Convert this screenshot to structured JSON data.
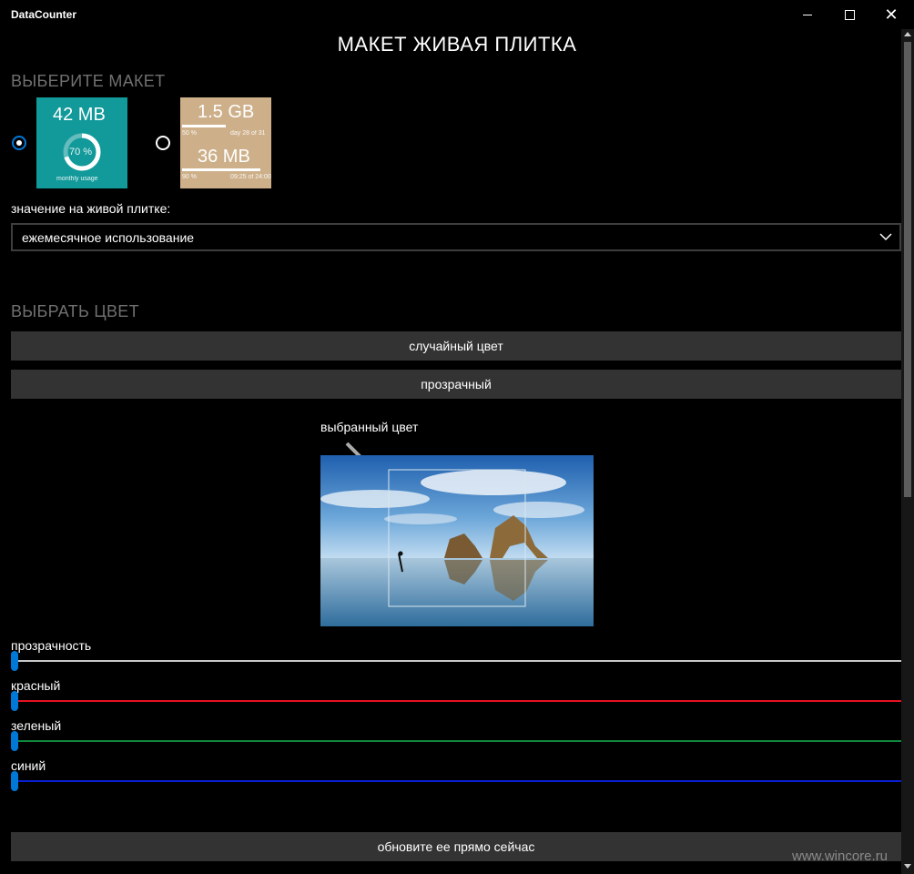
{
  "window": {
    "title": "DataCounter"
  },
  "page": {
    "heading": "МАКЕТ ЖИВАЯ ПЛИТКА"
  },
  "layout_section": {
    "title": "ВЫБЕРИТЕ МАКЕТ",
    "options": [
      {
        "selected": true,
        "tile": {
          "color": "#12999a",
          "value": "42 MB",
          "percent": "70 %",
          "percent_value": 0.7,
          "caption": "monthly usage"
        }
      },
      {
        "selected": false,
        "tile": {
          "color": "#cdb08a",
          "value1": "1.5 GB",
          "percent1": "50 %",
          "day": "day 28 of 31",
          "value2": "36 MB",
          "percent2": "90 %",
          "time": "09:25 of 24:00"
        }
      }
    ],
    "value_label": "значение на живой плитке:",
    "value_selected": "ежемесячное использование"
  },
  "color_section": {
    "title": "ВЫБРАТЬ ЦВЕТ",
    "random_button": "случайный цвет",
    "transparent_button": "прозрачный",
    "selected_color_label": "выбранный цвет"
  },
  "sliders": [
    {
      "label": "прозрачность",
      "value": 0,
      "color": "#c8c8c8"
    },
    {
      "label": "красный",
      "value": 0,
      "color": "#e81123"
    },
    {
      "label": "зеленый",
      "value": 0,
      "color": "#10893e"
    },
    {
      "label": "синий",
      "value": 0,
      "color": "#0a1fd8"
    }
  ],
  "update_button": "обновите ее прямо сейчас",
  "watermark": "www.wincore.ru",
  "colors": {
    "accent": "#0078d7",
    "button_bg": "#333333",
    "section_title": "#707070"
  }
}
